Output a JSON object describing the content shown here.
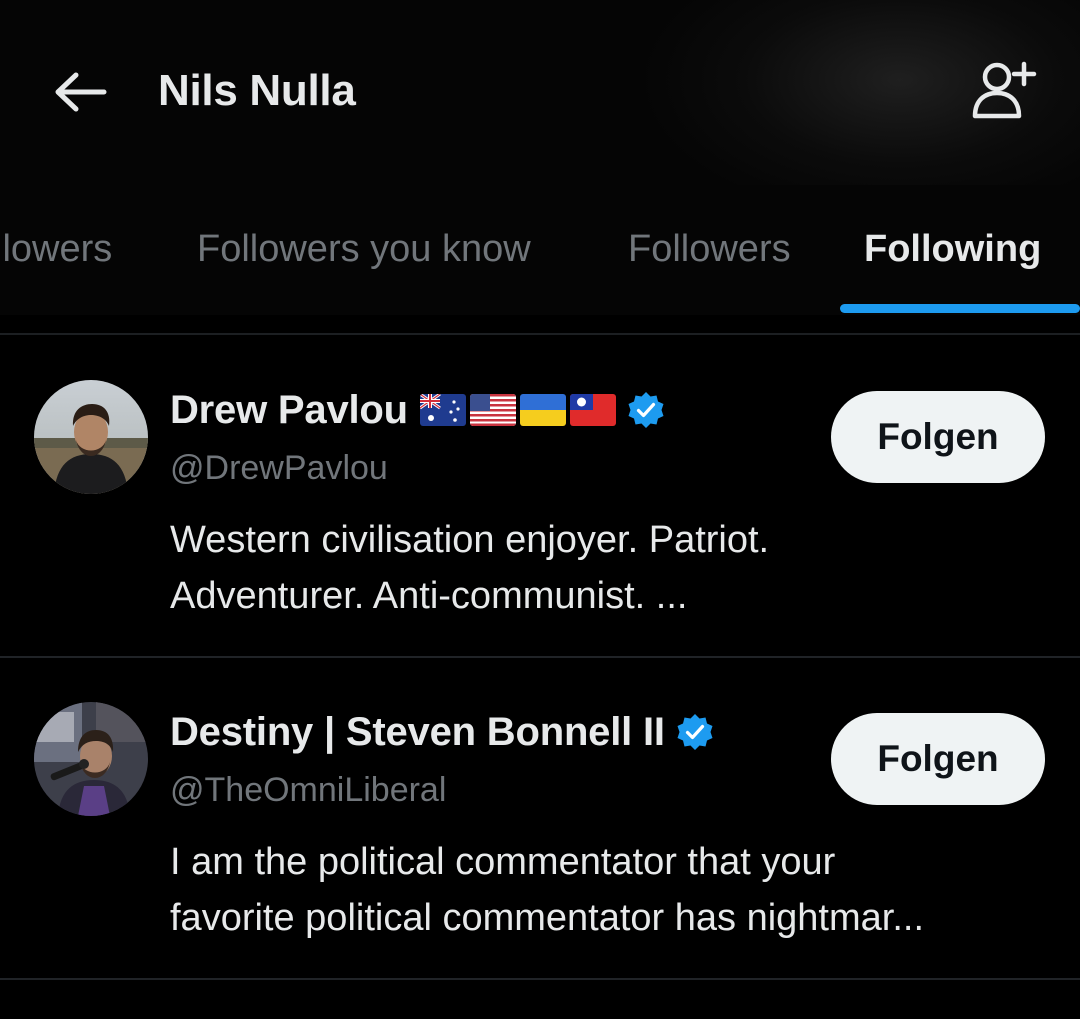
{
  "header": {
    "title": "Nils Nulla",
    "back_icon": "arrow-left-icon",
    "add_icon": "add-user-icon"
  },
  "tabs": [
    {
      "label": "llowers",
      "active": false
    },
    {
      "label": "Followers you know",
      "active": false
    },
    {
      "label": "Followers",
      "active": false
    },
    {
      "label": "Following",
      "active": true
    }
  ],
  "users": [
    {
      "name": "Drew Pavlou",
      "flags": [
        "flag-australia",
        "flag-usa",
        "flag-ukraine",
        "flag-taiwan"
      ],
      "verified": true,
      "handle": "@DrewPavlou",
      "bio_line1": "Western civilisation enjoyer. Patriot.",
      "bio_line2": "Adventurer. Anti-communist. ...",
      "follow_label": "Folgen"
    },
    {
      "name": "Destiny | Steven Bonnell II",
      "verified": true,
      "handle": "@TheOmniLiberal",
      "bio_line1": "I am the political commentator that your",
      "bio_line2": "favorite political commentator has nightmar...",
      "follow_label": "Folgen"
    }
  ],
  "colors": {
    "accent": "#1d9bf0",
    "muted_text": "#71767b",
    "primary_text": "#e7e9ea",
    "button_bg": "#eff3f4"
  }
}
